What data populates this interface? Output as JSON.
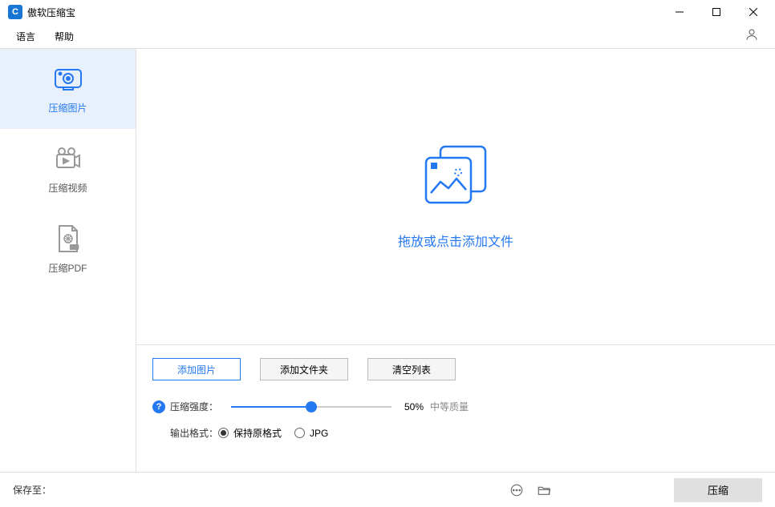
{
  "app": {
    "title": "傲软压缩宝"
  },
  "menubar": {
    "language": "语言",
    "help": "帮助"
  },
  "sidebar": {
    "items": [
      {
        "label": "压缩图片",
        "active": true
      },
      {
        "label": "压缩视频",
        "active": false
      },
      {
        "label": "压缩PDF",
        "active": false
      }
    ]
  },
  "dropzone": {
    "hint": "拖放或点击添加文件"
  },
  "buttons": {
    "add_image": "添加图片",
    "add_folder": "添加文件夹",
    "clear_list": "清空列表"
  },
  "compression": {
    "strength_label": "压缩强度：",
    "percent": "50%",
    "quality": "中等质量"
  },
  "output": {
    "label": "输出格式：",
    "keep_original": "保持原格式",
    "jpg": "JPG"
  },
  "footer": {
    "save_to": "保存至：",
    "compress": "压缩"
  }
}
